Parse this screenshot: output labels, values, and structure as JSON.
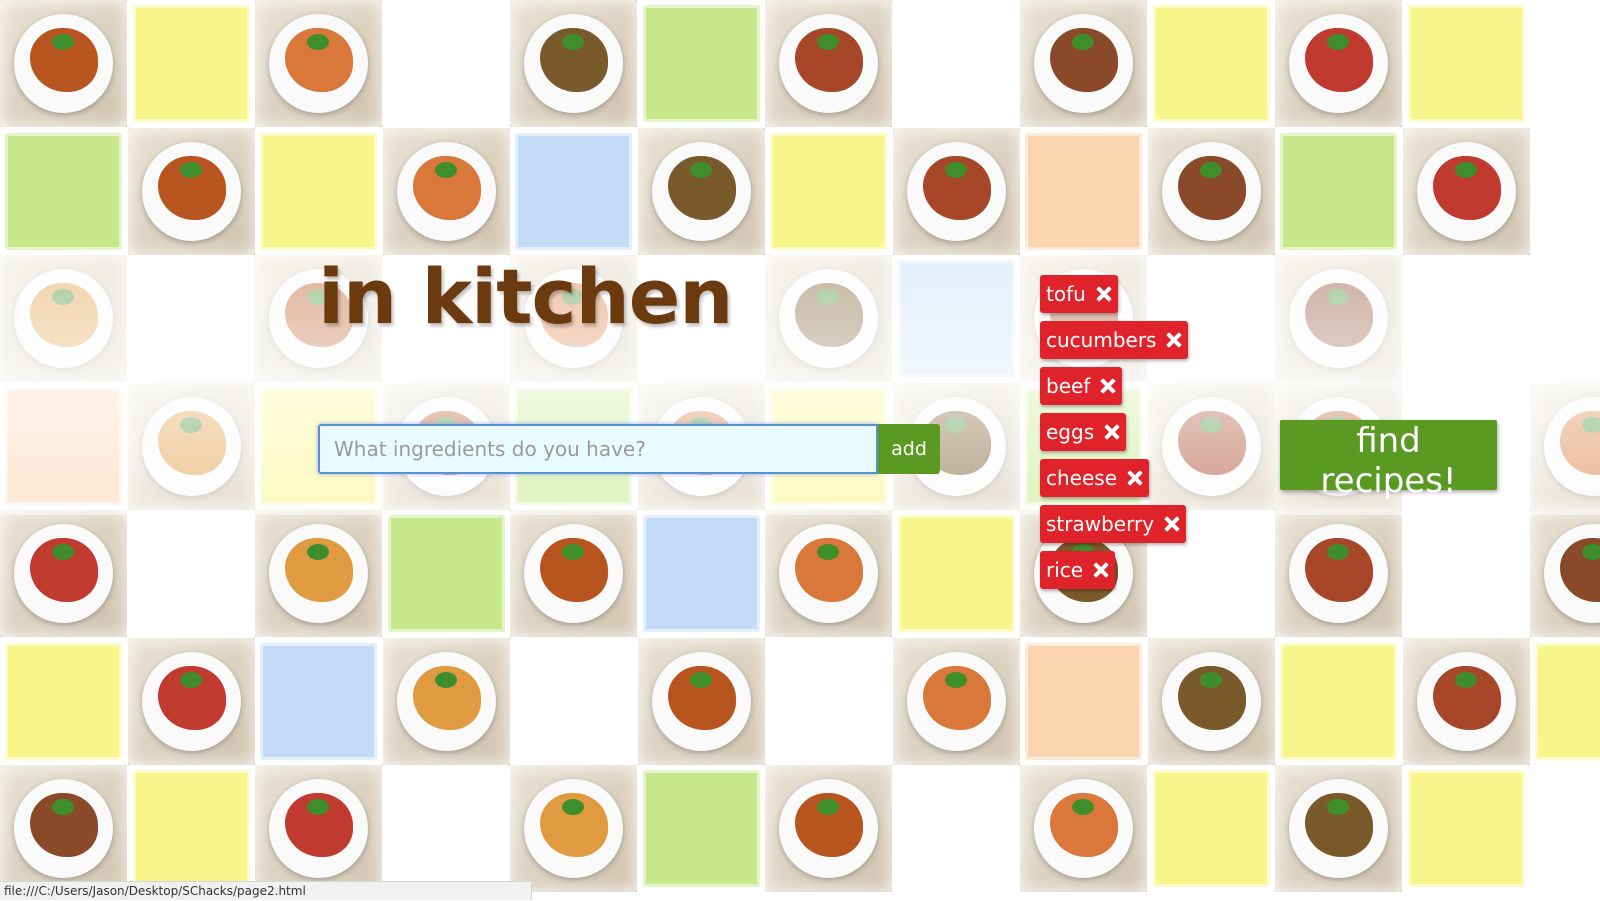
{
  "app": {
    "title": "in kitchen"
  },
  "search": {
    "placeholder": "What ingredients do you have?",
    "value": "",
    "add_label": "add"
  },
  "ingredients": [
    {
      "label": "tofu",
      "remove_icon": "close-icon"
    },
    {
      "label": "cucumbers",
      "remove_icon": "close-icon"
    },
    {
      "label": "beef",
      "remove_icon": "close-icon"
    },
    {
      "label": "eggs",
      "remove_icon": "close-icon"
    },
    {
      "label": "cheese",
      "remove_icon": "close-icon"
    },
    {
      "label": "strawberry",
      "remove_icon": "close-icon"
    },
    {
      "label": "rice",
      "remove_icon": "close-icon"
    }
  ],
  "actions": {
    "find_label": "find recipes!"
  },
  "status_bar": {
    "url": "file:///C:/Users/Jason/Desktop/SChacks/page2.html"
  },
  "colors": {
    "title": "#6b3a0e",
    "chip": "#e0232b",
    "button": "#5a9a22",
    "input_border": "#5a8fd6",
    "input_bg": "#e8fbff"
  },
  "background": {
    "tiles": [
      "dish",
      "yellow",
      "dish",
      "white",
      "dish",
      "green",
      "dish",
      "white",
      "dish",
      "yellow",
      "dish",
      "yellow",
      "white",
      "green",
      "dish",
      "yellow",
      "dish",
      "blue",
      "dish",
      "yellow",
      "dish",
      "peach",
      "dish",
      "green",
      "dish",
      "white",
      "dish",
      "white",
      "dish",
      "white",
      "dish",
      "white",
      "dish",
      "blue",
      "dish",
      "white",
      "dish",
      "white",
      "white",
      "peach",
      "dish",
      "yellow",
      "dish",
      "green",
      "dish",
      "yellow",
      "dish",
      "green",
      "dish",
      "dish",
      "white",
      "dish",
      "dish",
      "white",
      "dish",
      "green",
      "dish",
      "blue",
      "dish",
      "yellow",
      "dish",
      "white",
      "dish",
      "white",
      "dish",
      "yellow",
      "dish",
      "blue",
      "dish",
      "white",
      "dish",
      "white",
      "dish",
      "peach",
      "dish",
      "yellow",
      "dish",
      "yellow",
      "dish",
      "yellow",
      "dish",
      "white",
      "dish",
      "green",
      "dish",
      "white",
      "dish",
      "yellow",
      "dish",
      "yellow",
      "white"
    ]
  }
}
